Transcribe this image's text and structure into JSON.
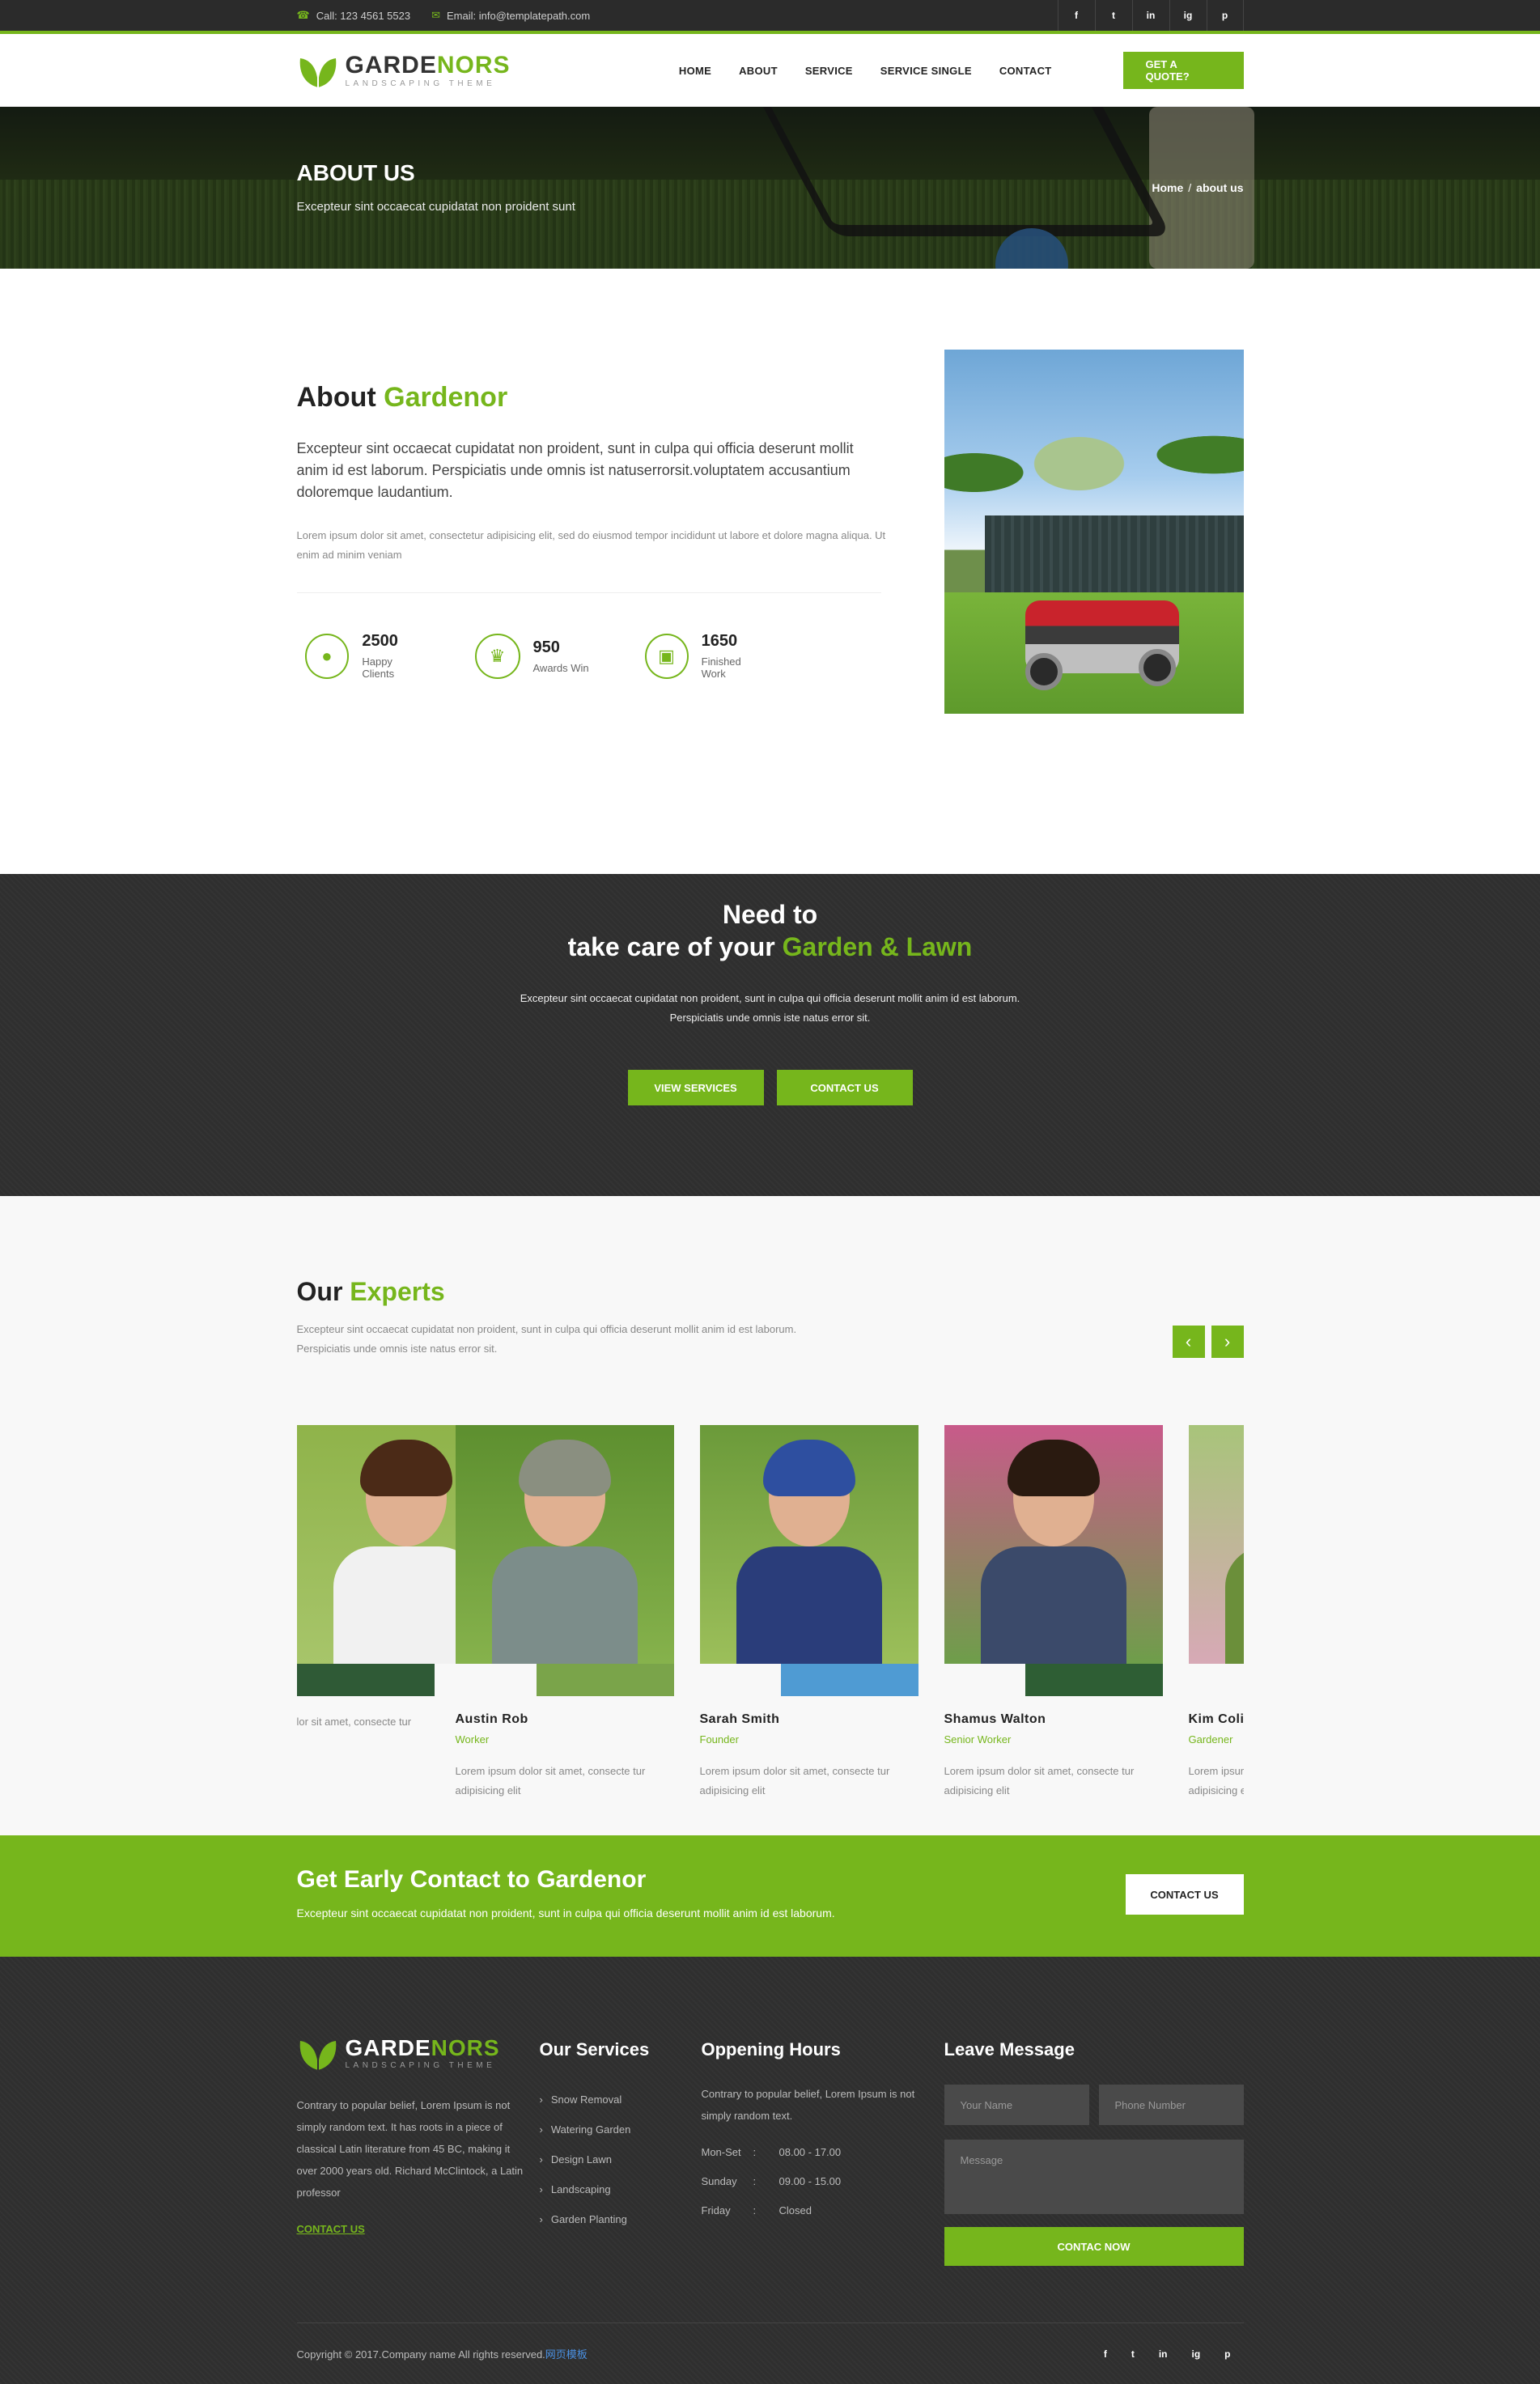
{
  "topbar": {
    "phone": "Call: 123 4561 5523",
    "email": "Email: info@templatepath.com",
    "social": [
      "f",
      "t",
      "in",
      "ig",
      "p"
    ]
  },
  "brand": {
    "name_a": "GARDE",
    "name_b": "NORS",
    "tagline": "LANDSCAPING THEME"
  },
  "nav": {
    "items": [
      "HOME",
      "ABOUT",
      "SERVICE",
      "SERVICE SINGLE",
      "CONTACT"
    ],
    "cta": "GET A QUOTE?"
  },
  "banner": {
    "title": "ABOUT US",
    "subtitle": "Excepteur sint occaecat cupidatat non proident sunt",
    "crumb_home": "Home",
    "crumb_sep": "/",
    "crumb_current": "about us"
  },
  "about": {
    "title_a": "About",
    "title_b": "Gardenor",
    "lead": "Excepteur sint occaecat cupidatat non proident, sunt in culpa qui officia deserunt mollit anim id est laborum. Perspiciatis unde omnis ist natuserrorsit.voluptatem accusantium doloremque laudantium.",
    "small": "Lorem ipsum dolor sit amet, consectetur adipisicing elit, sed do eiusmod tempor incididunt ut labore et dolore magna aliqua. Ut enim ad minim veniam",
    "stats": [
      {
        "num": "2500",
        "label": "Happy Clients",
        "icon": "user-icon"
      },
      {
        "num": "950",
        "label": "Awards Win",
        "icon": "trophy-icon"
      },
      {
        "num": "1650",
        "label": "Finished Work",
        "icon": "mower-icon"
      }
    ]
  },
  "cta": {
    "line1": "Need to",
    "line2_a": "take care of your",
    "line2_b": "Garden & Lawn",
    "text": "Excepteur sint occaecat cupidatat non proident, sunt in culpa qui officia deserunt mollit anim id est laborum. Perspiciatis unde omnis iste natus error sit.",
    "btn1": "VIEW SERVICES",
    "btn2": "CONTACT US"
  },
  "experts": {
    "title_a": "Our",
    "title_b": "Experts",
    "intro": "Excepteur sint occaecat cupidatat non proident, sunt in culpa qui officia deserunt mollit anim id est laborum. Perspiciatis unde omnis iste natus error sit.",
    "prev": "‹",
    "next": "›",
    "members": [
      {
        "name": "",
        "role": "",
        "desc": "lor sit amet, consecte tur"
      },
      {
        "name": "Austin Rob",
        "role": "Worker",
        "desc": "Lorem ipsum dolor sit amet, consecte tur adipisicing elit"
      },
      {
        "name": "Sarah Smith",
        "role": "Founder",
        "desc": "Lorem ipsum dolor sit amet, consecte tur adipisicing elit"
      },
      {
        "name": "Shamus Walton",
        "role": "Senior Worker",
        "desc": "Lorem ipsum dolor sit amet, consecte tur adipisicing elit"
      },
      {
        "name": "Kim Colin",
        "role": "Gardener",
        "desc": "Lorem ipsum dolor sit amet, consecte tur adipisicing elit"
      }
    ]
  },
  "early": {
    "title": "Get Early Contact to Gardenor",
    "text": "Excepteur sint occaecat cupidatat non proident, sunt in culpa qui officia deserunt mollit anim id est laborum.",
    "btn": "CONTACT US"
  },
  "footer": {
    "about": "Contrary to popular belief, Lorem Ipsum is not simply random text. It has roots in a piece of classical Latin literature from 45 BC, making it over 2000 years old. Richard McClintock, a Latin professor",
    "about_link": "CONTACT US",
    "services_title": "Our Services",
    "services": [
      "Snow Removal",
      "Watering Garden",
      "Design Lawn",
      "Landscaping",
      "Garden Planting"
    ],
    "hours_title": "Oppening Hours",
    "hours_text": "Contrary to popular belief, Lorem Ipsum is not simply random text.",
    "hours": [
      {
        "day": "Mon-Set",
        "colon": ":",
        "time": "08.00 - 17.00"
      },
      {
        "day": "Sunday",
        "colon": ":",
        "time": "09.00 - 15.00"
      },
      {
        "day": "Friday",
        "colon": ":",
        "time": "Closed"
      }
    ],
    "message_title": "Leave Message",
    "name_placeholder": "Your Name",
    "phone_placeholder": "Phone Number",
    "message_placeholder": "Message",
    "send": "CONTAC NOW",
    "copyright": "Copyright © 2017.Company name All rights reserved.",
    "copyright_link": "网页模板",
    "social": [
      "f",
      "t",
      "in",
      "ig",
      "p"
    ]
  },
  "colors": {
    "accent": "#76b61c",
    "dark": "#2f2f2f"
  }
}
